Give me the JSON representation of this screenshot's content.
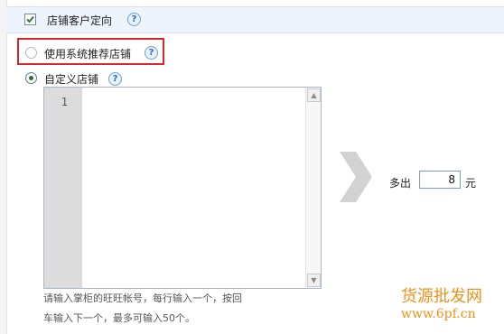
{
  "header": {
    "title": "店铺客户定向",
    "checked": true
  },
  "options": {
    "system_recommend": {
      "label": "使用系统推荐店铺",
      "selected": false
    },
    "custom": {
      "label": "自定义店铺",
      "selected": true
    }
  },
  "editor": {
    "line_number": "1",
    "value": "",
    "hint_line1": "请输入掌柜的旺旺帐号，每行输入一个，按回",
    "hint_line2": "车输入下一个，最多可输入50个。"
  },
  "extra": {
    "prefix": "多出",
    "value": "8",
    "suffix": "元"
  },
  "help_glyph": "?",
  "watermark": {
    "line1": "货源批发网",
    "line2": "www.6pf.cn"
  },
  "colors": {
    "highlight": "#d9262c",
    "header_bg": "#eef4fb",
    "watermark": "#f09016"
  }
}
